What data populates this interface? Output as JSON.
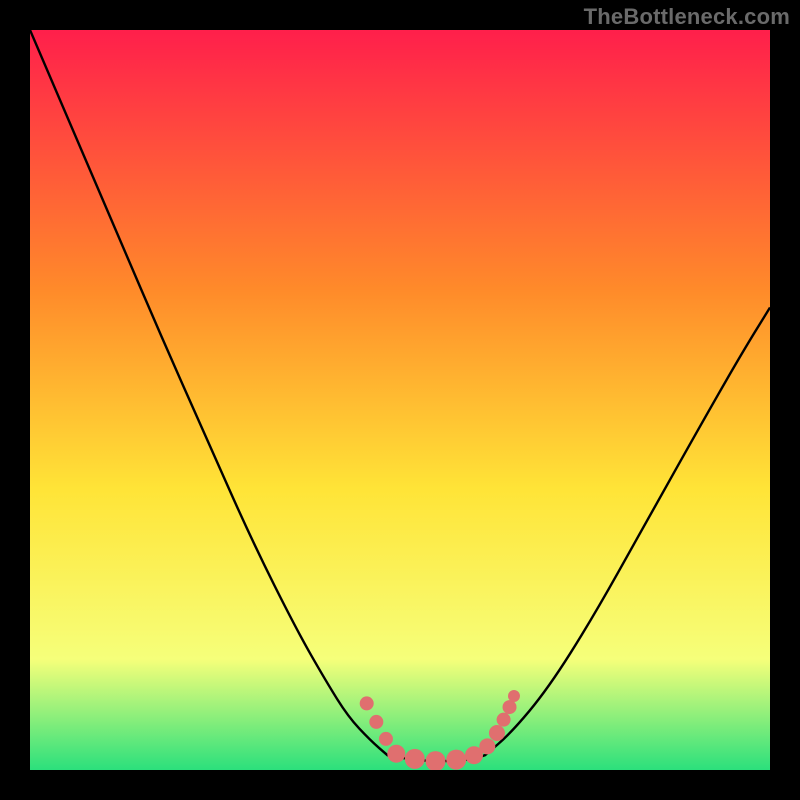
{
  "attribution": "TheBottleneck.com",
  "colors": {
    "frame": "#000000",
    "gradient_top": "#ff1f4b",
    "gradient_mid1": "#ff8a2a",
    "gradient_mid2": "#ffe437",
    "gradient_mid3": "#f6ff7a",
    "gradient_bottom": "#2be07c",
    "curve": "#000000",
    "marker": "#e06f6f",
    "attribution_text": "#6a6a6a"
  },
  "chart_data": {
    "type": "line",
    "title": "",
    "xlabel": "",
    "ylabel": "",
    "xlim": [
      0,
      1
    ],
    "ylim": [
      0,
      1
    ],
    "note": "x is normalized horizontal position (0=left of plot, 1=right); y is normalized vertical position (0=top, 1=bottom) matching the gradient where top=red and bottom=green. Values estimated from pixels.",
    "series": [
      {
        "name": "left-branch",
        "x": [
          0.0,
          0.06,
          0.12,
          0.18,
          0.24,
          0.3,
          0.36,
          0.4,
          0.43,
          0.46,
          0.483
        ],
        "y": [
          0.0,
          0.14,
          0.28,
          0.42,
          0.555,
          0.69,
          0.81,
          0.88,
          0.928,
          0.96,
          0.98
        ]
      },
      {
        "name": "valley-floor",
        "x": [
          0.483,
          0.51,
          0.54,
          0.57,
          0.6,
          0.615
        ],
        "y": [
          0.98,
          0.985,
          0.988,
          0.988,
          0.985,
          0.98
        ]
      },
      {
        "name": "right-branch",
        "x": [
          0.615,
          0.65,
          0.7,
          0.76,
          0.83,
          0.9,
          0.96,
          1.0
        ],
        "y": [
          0.98,
          0.95,
          0.89,
          0.795,
          0.67,
          0.545,
          0.44,
          0.375
        ]
      }
    ],
    "markers": {
      "name": "highlighted-points",
      "color": "#e06f6f",
      "points": [
        {
          "x": 0.455,
          "y": 0.91,
          "r": 7
        },
        {
          "x": 0.468,
          "y": 0.935,
          "r": 7
        },
        {
          "x": 0.481,
          "y": 0.958,
          "r": 7
        },
        {
          "x": 0.495,
          "y": 0.978,
          "r": 9
        },
        {
          "x": 0.52,
          "y": 0.985,
          "r": 10
        },
        {
          "x": 0.548,
          "y": 0.988,
          "r": 10
        },
        {
          "x": 0.576,
          "y": 0.986,
          "r": 10
        },
        {
          "x": 0.6,
          "y": 0.98,
          "r": 9
        },
        {
          "x": 0.618,
          "y": 0.968,
          "r": 8
        },
        {
          "x": 0.631,
          "y": 0.95,
          "r": 8
        },
        {
          "x": 0.64,
          "y": 0.932,
          "r": 7
        },
        {
          "x": 0.648,
          "y": 0.915,
          "r": 7
        },
        {
          "x": 0.654,
          "y": 0.9,
          "r": 6
        }
      ]
    }
  }
}
